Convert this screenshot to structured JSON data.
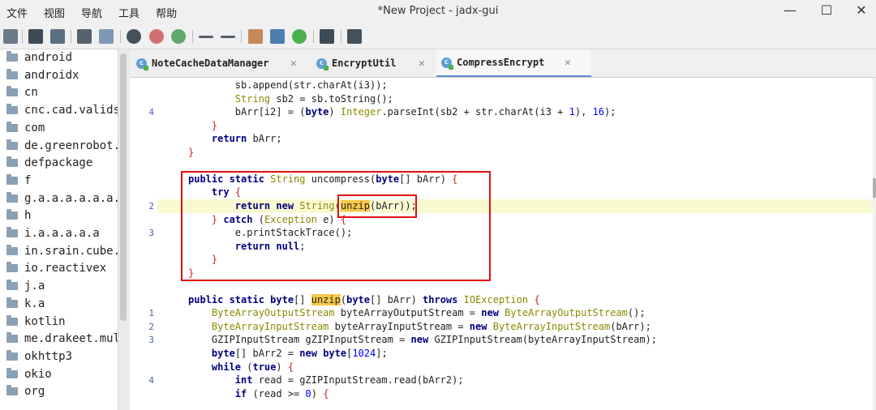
{
  "menu": [
    "文件",
    "视图",
    "导航",
    "工具",
    "帮助"
  ],
  "window_title": "*New Project - jadx-gui",
  "window_controls": {
    "minimize": "—",
    "maximize": "☐",
    "close": "✕"
  },
  "toolbar_icons": [
    "open-file-icon",
    "save-icon",
    "export-icon",
    "sync-icon",
    "folder-icon",
    "search-icon",
    "find-class-icon",
    "find-usage-icon",
    "back-icon",
    "forward-icon",
    "deobfuscation-icon",
    "quick-tab-icon",
    "bug-icon",
    "log-icon",
    "settings-icon"
  ],
  "tree": [
    "android",
    "androidx",
    "cn",
    "cnc.cad.valids",
    "com",
    "de.greenrobot.",
    "defpackage",
    "f",
    "g.a.a.a.a.a.a.",
    "h",
    "i.a.a.a.a.a",
    "in.srain.cube.",
    "io.reactivex",
    "j.a",
    "k.a",
    "kotlin",
    "me.drakeet.mul",
    "okhttp3",
    "okio",
    "org"
  ],
  "tabs": [
    "NoteCacheDataManager",
    "EncryptUtil",
    "CompressEncrypt"
  ],
  "tab_close": "✕",
  "lines": [
    {
      "ln": "",
      "html": "        sb.append(str.charAt(i3));"
    },
    {
      "ln": "",
      "html": "        <span class=\"ty\">String</span> sb2 = sb.toString();"
    },
    {
      "ln": "4",
      "html": "        bArr[i2] = (<span class=\"kw\">byte</span>) <span class=\"ty\">Integer</span>.parseInt(sb2 + str.charAt(i3 + <span class=\"num\">1</span>), <span class=\"num\">16</span>);"
    },
    {
      "ln": "",
      "html": "    <span class=\"red\">}</span>"
    },
    {
      "ln": "",
      "html": "    <span class=\"kw\">return</span> bArr;"
    },
    {
      "ln": "",
      "html": "<span class=\"red\">}</span>"
    },
    {
      "ln": "",
      "html": ""
    },
    {
      "ln": "",
      "html": "<span class=\"kw\">public static</span> <span class=\"ty\">String</span> uncompress(<span class=\"kw\">byte</span>[] bArr) <span class=\"red\">{</span>"
    },
    {
      "ln": "",
      "html": "    <span class=\"kw\">try</span> <span class=\"red\">{</span>"
    },
    {
      "ln": "2",
      "html": "        <span class=\"kw\">return new</span> <span class=\"ty\">String</span>(<span class=\"mark\">unzip</span>(bArr));"
    },
    {
      "ln": "",
      "html": "    <span class=\"red\">}</span> <span class=\"kw\">catch</span> (<span class=\"ty\">Exception</span> e) <span class=\"red\">{</span>"
    },
    {
      "ln": "3",
      "html": "        e.printStackTrace();"
    },
    {
      "ln": "",
      "html": "        <span class=\"kw\">return null</span>;"
    },
    {
      "ln": "",
      "html": "    <span class=\"red\">}</span>"
    },
    {
      "ln": "",
      "html": "<span class=\"red\">}</span>"
    },
    {
      "ln": "",
      "html": ""
    },
    {
      "ln": "",
      "html": "<span class=\"kw\">public static byte</span>[] <span class=\"mark\">unzip</span>(<span class=\"kw\">byte</span>[] bArr) <span class=\"kw\">throws</span> <span class=\"ty\">IOException</span> <span class=\"red\">{</span>"
    },
    {
      "ln": "1",
      "html": "    <span class=\"ty\">ByteArrayOutputStream</span> byteArrayOutputStream = <span class=\"kw\">new</span> <span class=\"ty\">ByteArrayOutputStream</span>();"
    },
    {
      "ln": "2",
      "html": "    <span class=\"ty\">ByteArrayInputStream</span> byteArrayInputStream = <span class=\"kw\">new</span> <span class=\"ty\">ByteArrayInputStream</span>(bArr);"
    },
    {
      "ln": "3",
      "html": "    GZIPInputStream gZIPInputStream = <span class=\"kw\">new</span> GZIPInputStream(byteArrayInputStream);"
    },
    {
      "ln": "",
      "html": "    <span class=\"kw\">byte</span>[] bArr2 = <span class=\"kw\">new byte</span>[<span class=\"num\">1024</span>];"
    },
    {
      "ln": "",
      "html": "    <span class=\"kw\">while</span> (<span class=\"kw\">true</span>) <span class=\"red\">{</span>"
    },
    {
      "ln": "4",
      "html": "        <span class=\"kw\">int</span> read = gZIPInputStream.read(bArr2);"
    },
    {
      "ln": "",
      "html": "        <span class=\"kw\">if</span> (read >= <span class=\"num\">0</span>) <span class=\"red\">{</span>"
    }
  ]
}
